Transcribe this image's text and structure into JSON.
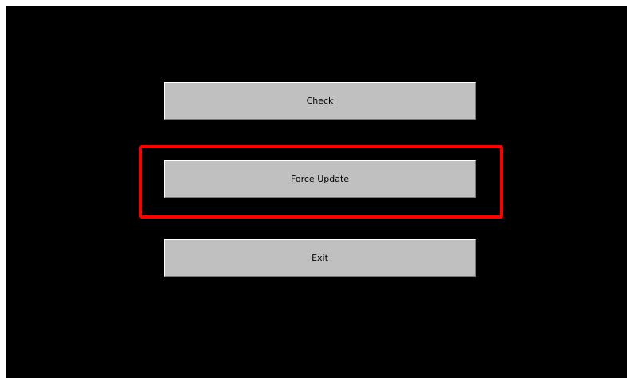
{
  "buttons": {
    "check_label": "Check",
    "force_update_label": "Force Update",
    "exit_label": "Exit"
  },
  "colors": {
    "screen_background": "#000000",
    "button_background": "#c0c0c0",
    "highlight": "#ff0000"
  }
}
